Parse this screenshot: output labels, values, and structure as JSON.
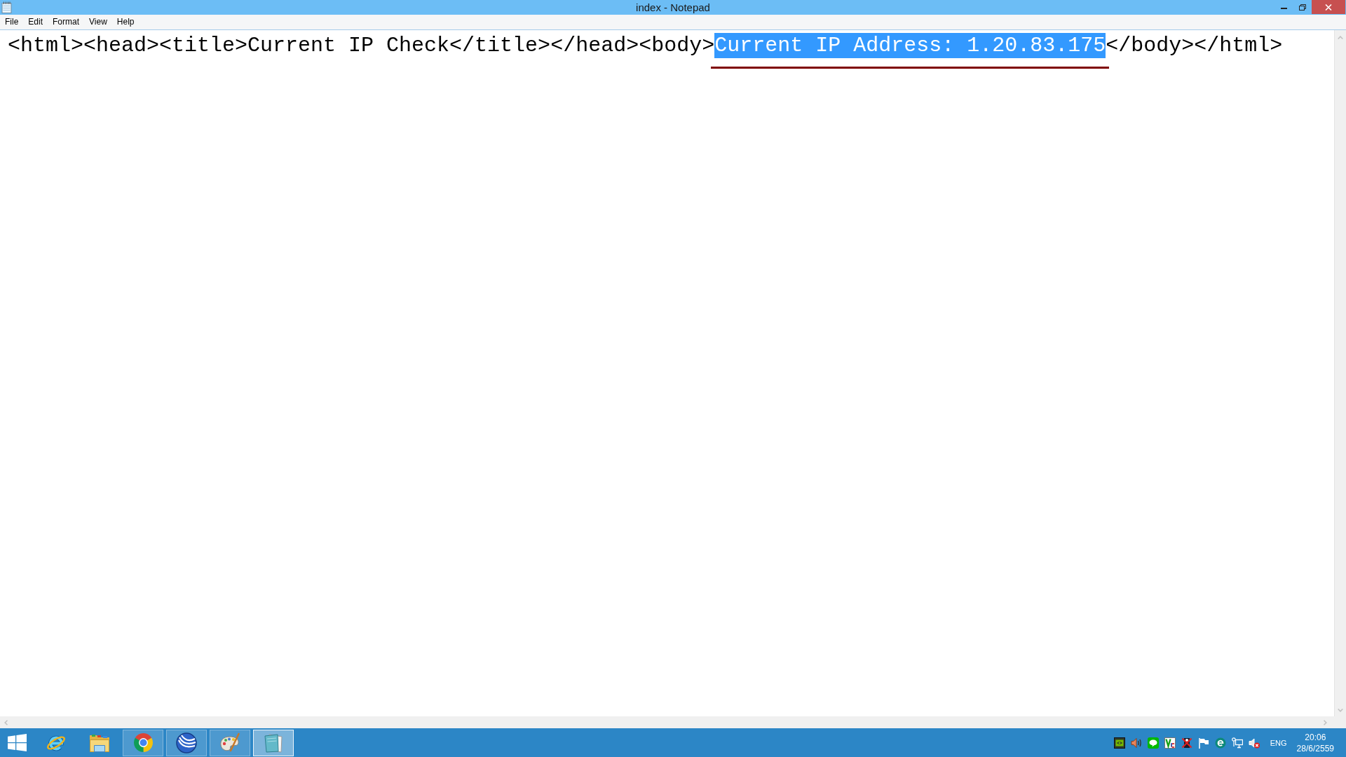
{
  "window": {
    "title": "index - Notepad"
  },
  "menu_bar": {
    "items": [
      "File",
      "Edit",
      "Format",
      "View",
      "Help"
    ]
  },
  "editor": {
    "lines": [
      {
        "segments": [
          {
            "text": "<html><head><title>Current IP Check</title></head><body>",
            "selected": false,
            "underlined": false
          },
          {
            "text": "Current IP Address: 1.20.83.175",
            "selected": true,
            "underlined": true
          },
          {
            "text": "</body></html>",
            "selected": false,
            "underlined": false
          }
        ]
      }
    ]
  },
  "taskbar": {
    "apps": [
      {
        "running": false,
        "selected": false
      },
      {
        "running": false,
        "selected": false
      },
      {
        "running": true,
        "selected": false
      },
      {
        "running": true,
        "selected": false
      },
      {
        "running": true,
        "selected": false
      },
      {
        "running": true,
        "selected": true
      }
    ],
    "tray": {
      "language": "ENG",
      "clock": {
        "time": "20:06",
        "date": "28/6/2559"
      }
    }
  }
}
